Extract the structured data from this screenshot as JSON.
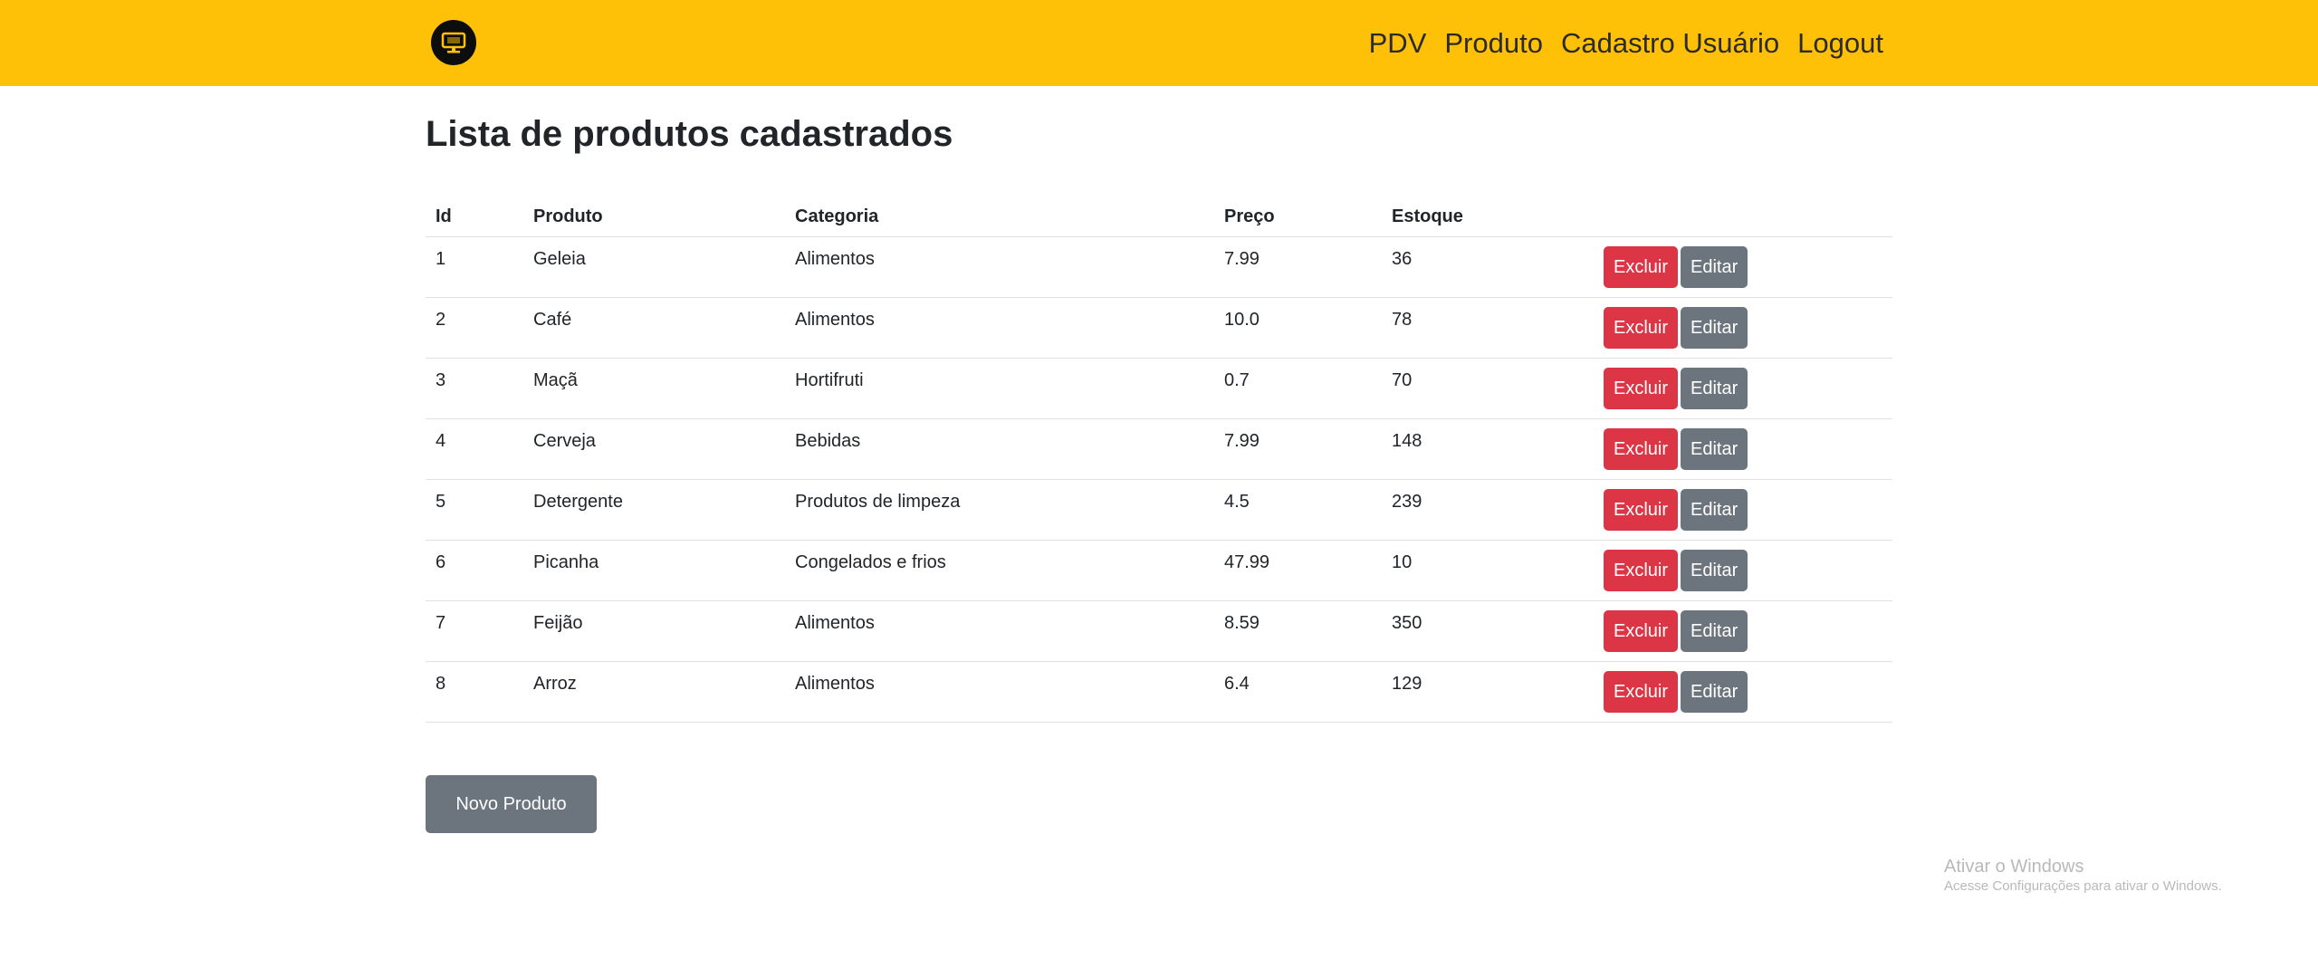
{
  "navbar": {
    "logo_icon": "monitor-icon",
    "links": [
      "PDV",
      "Produto",
      "Cadastro Usuário",
      "Logout"
    ],
    "background": "#ffc107"
  },
  "page": {
    "title": "Lista de produtos cadastrados"
  },
  "table": {
    "headers": [
      "Id",
      "Produto",
      "Categoria",
      "Preço",
      "Estoque",
      ""
    ],
    "rows": [
      {
        "id": "1",
        "produto": "Geleia",
        "categoria": "Alimentos",
        "preco": "7.99",
        "estoque": "36"
      },
      {
        "id": "2",
        "produto": "Café",
        "categoria": "Alimentos",
        "preco": "10.0",
        "estoque": "78"
      },
      {
        "id": "3",
        "produto": "Maçã",
        "categoria": "Hortifruti",
        "preco": "0.7",
        "estoque": "70"
      },
      {
        "id": "4",
        "produto": "Cerveja",
        "categoria": "Bebidas",
        "preco": "7.99",
        "estoque": "148"
      },
      {
        "id": "5",
        "produto": "Detergente",
        "categoria": "Produtos de limpeza",
        "preco": "4.5",
        "estoque": "239"
      },
      {
        "id": "6",
        "produto": "Picanha",
        "categoria": "Congelados e frios",
        "preco": "47.99",
        "estoque": "10"
      },
      {
        "id": "7",
        "produto": "Feijão",
        "categoria": "Alimentos",
        "preco": "8.59",
        "estoque": "350"
      },
      {
        "id": "8",
        "produto": "Arroz",
        "categoria": "Alimentos",
        "preco": "6.4",
        "estoque": "129"
      }
    ],
    "delete_label": "Excluir",
    "edit_label": "Editar"
  },
  "actions": {
    "new_product_label": "Novo Produto"
  },
  "watermark": {
    "title": "Ativar o Windows",
    "subtitle": "Acesse Configurações para ativar o Windows."
  },
  "colors": {
    "accent": "#ffc107",
    "danger": "#dc3545",
    "secondary": "#6c757d"
  }
}
